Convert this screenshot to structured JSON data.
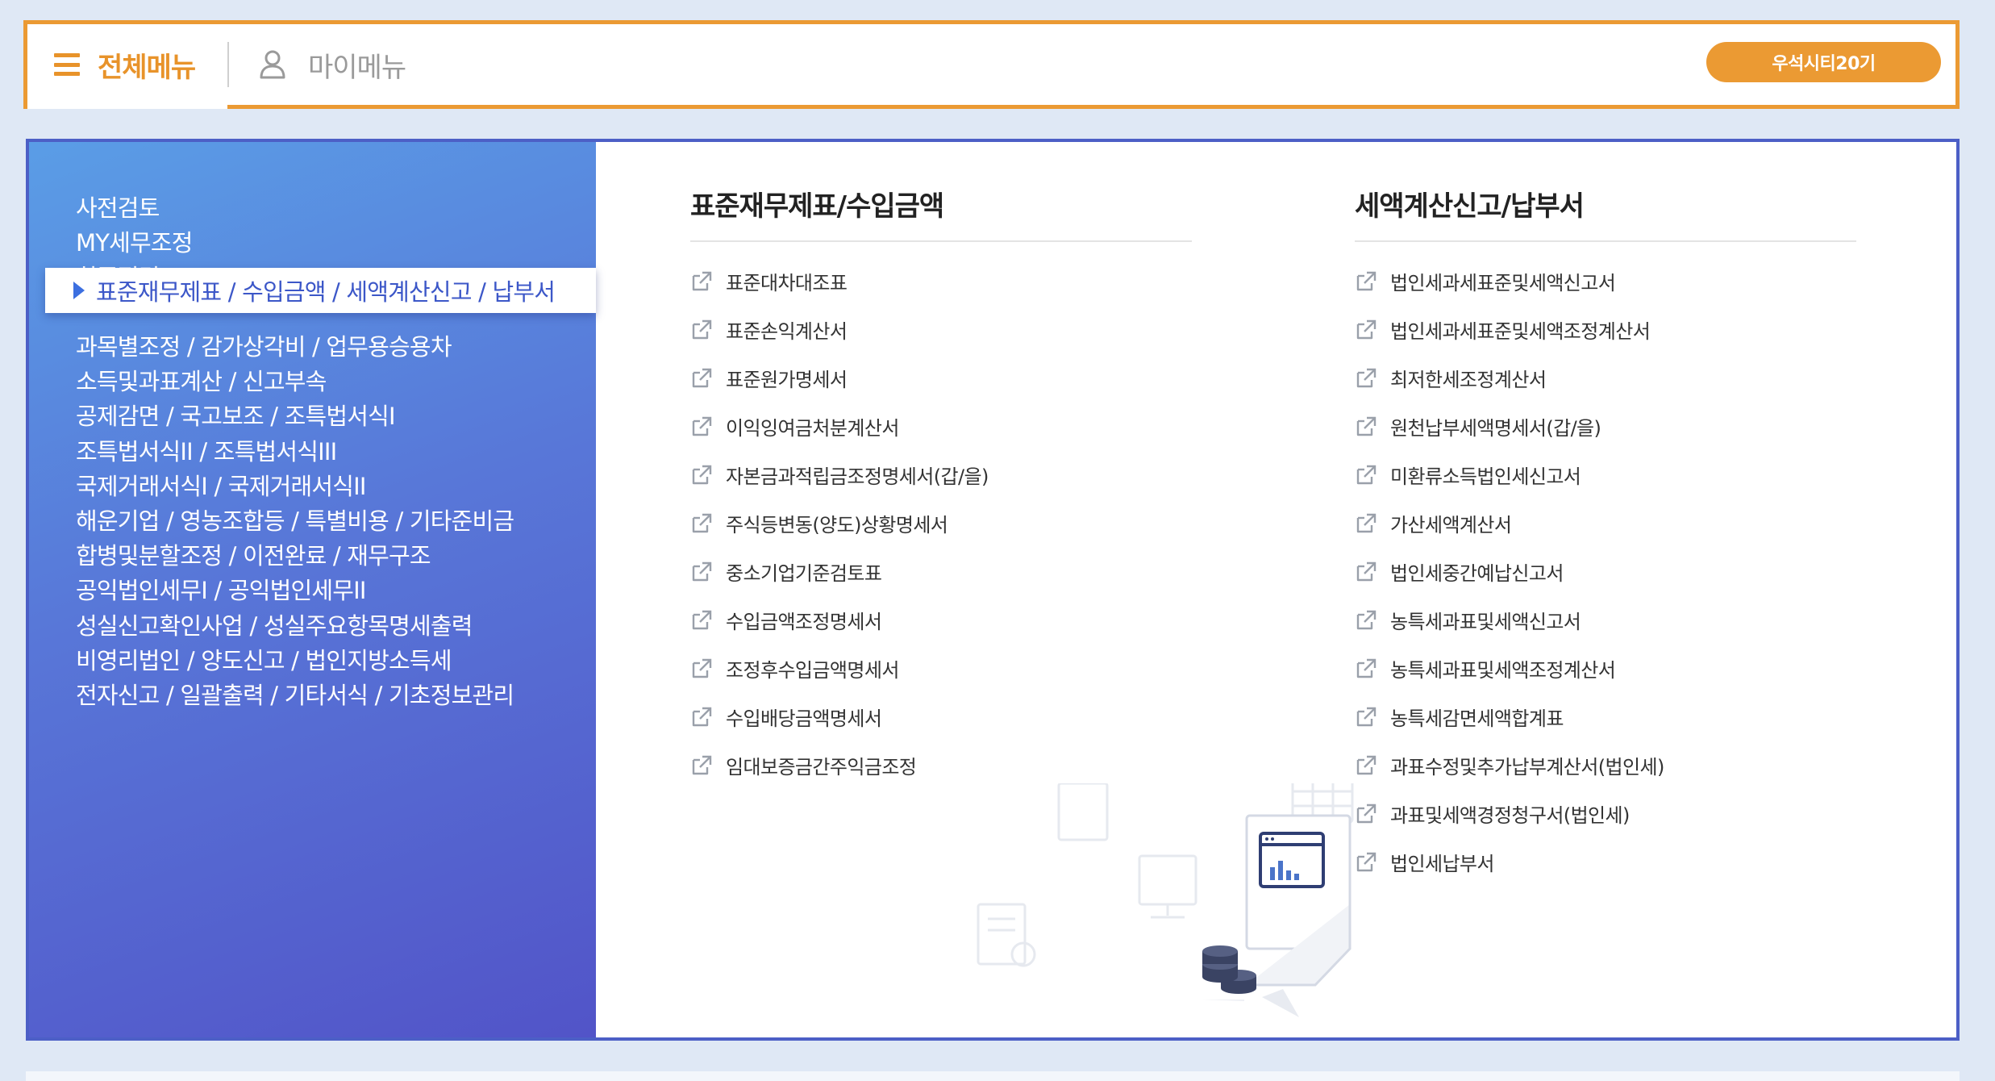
{
  "topbar": {
    "tabs": [
      {
        "label": "전체메뉴",
        "icon": "hamburger-menu-icon"
      },
      {
        "label": "마이메뉴",
        "icon": "user-icon"
      }
    ],
    "badge": "우석시티20기"
  },
  "sidebar": {
    "items": [
      {
        "label": "사전검토"
      },
      {
        "label": "MY세무조정"
      },
      {
        "label": "최종점검"
      },
      {
        "label": "표준재무제표 / 수입금액 / 세액계산신고 / 납부서",
        "active": true
      },
      {
        "label": "과목별조정 / 감가상각비 / 업무용승용차"
      },
      {
        "label": "소득및과표계산 / 신고부속"
      },
      {
        "label": "공제감면 / 국고보조 / 조특법서식I"
      },
      {
        "label": "조특법서식II / 조특법서식III"
      },
      {
        "label": "국제거래서식I / 국제거래서식II"
      },
      {
        "label": "해운기업 / 영농조합등 / 특별비용 / 기타준비금"
      },
      {
        "label": "합병및분할조정 / 이전완료 / 재무구조"
      },
      {
        "label": "공익법인세무I / 공익법인세무II"
      },
      {
        "label": "성실신고확인사업 / 성실주요항목명세출력"
      },
      {
        "label": "비영리법인 / 양도신고 / 법인지방소득세"
      },
      {
        "label": "전자신고 / 일괄출력 / 기타서식 / 기초정보관리"
      }
    ]
  },
  "columns": [
    {
      "title": "표준재무제표/수입금액",
      "links": [
        "표준대차대조표",
        "표준손익계산서",
        "표준원가명세서",
        "이익잉여금처분계산서",
        "자본금과적립금조정명세서(갑/을)",
        "주식등변동(양도)상황명세서",
        "중소기업기준검토표",
        "수입금액조정명세서",
        "조정후수입금액명세서",
        "수입배당금액명세서",
        "임대보증금간주익금조정"
      ]
    },
    {
      "title": "세액계산신고/납부서",
      "links": [
        "법인세과세표준및세액신고서",
        "법인세과세표준및세액조정계산서",
        "최저한세조정계산서",
        "원천납부세액명세서(갑/을)",
        "미환류소득법인세신고서",
        "가산세액계산서",
        "법인세중간예납신고서",
        "농특세과표및세액신고서",
        "농특세과표및세액조정계산서",
        "농특세감면세액합계표",
        "과표수정및추가납부계산서(법인세)",
        "과표및세액경정청구서(법인세)",
        "법인세납부서"
      ]
    }
  ],
  "icons": {
    "link": "external-link-icon",
    "decoration": "report-chart-illustration"
  },
  "colors": {
    "accent_orange": "#eb9a33",
    "sidebar_blue": "#5877d8",
    "active_blue": "#3c57c8"
  }
}
